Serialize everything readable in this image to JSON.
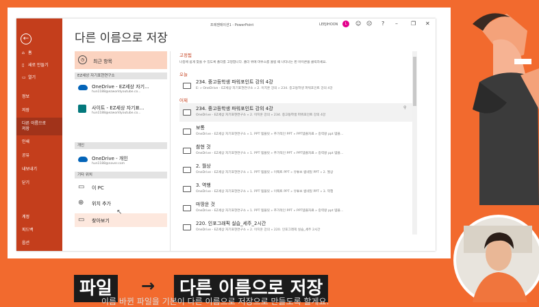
{
  "app": {
    "doc_title": "프레젠테이션1 - PowerPoint",
    "user_name": "LEEJIHOON",
    "user_initial": "L",
    "page_title": "다른 이름으로 저장"
  },
  "nav": {
    "back_icon": "←",
    "items": [
      {
        "icon": "⌂",
        "label": "홈"
      },
      {
        "icon": "▯",
        "label": "새로 만들기"
      },
      {
        "icon": "▭",
        "label": "열기"
      },
      {
        "icon": "",
        "label": "정보"
      },
      {
        "icon": "",
        "label": "저장"
      },
      {
        "icon": "",
        "label": "다른 이름으로"
      },
      {
        "icon": "",
        "label": "저장"
      },
      {
        "icon": "",
        "label": "인쇄"
      },
      {
        "icon": "",
        "label": "공유"
      },
      {
        "icon": "",
        "label": "내보내기"
      },
      {
        "icon": "",
        "label": "닫기"
      },
      {
        "icon": "",
        "label": "계정"
      },
      {
        "icon": "",
        "label": "피드백"
      },
      {
        "icon": "",
        "label": "옵션"
      }
    ]
  },
  "locations": {
    "recent": "최근 항목",
    "section_org": "EZ세상 자기표현연구소",
    "org_items": [
      {
        "line1": "OneDrive - EZ세상 자기...",
        "line2": "hun1188@ezworldyoutube.co..."
      },
      {
        "line1": "사이트 - EZ세상 자기표...",
        "line2": "hun1188@ezworldyoutube.co..."
      }
    ],
    "section_personal": "개인",
    "personal_items": [
      {
        "line1": "OneDrive - 개인",
        "line2": "hun1188@naver.com"
      }
    ],
    "section_other": "기타 위치",
    "other_items": [
      {
        "label": "이 PC"
      },
      {
        "label": "위치 추가"
      },
      {
        "label": "찾아보기"
      }
    ]
  },
  "files": {
    "pinned_header": "고정됨",
    "pinned_desc": "나중에 쉽게 찾을 수 있도록 폴더를 고정합니다. 폴더 위에 마우스를 올릴 때 나타나는 핀 아이콘을 클릭하세요.",
    "today_header": "오늘",
    "yesterday_header": "어제",
    "today": [
      {
        "name": "234. 중고등학생 파워포인트 강의 4강",
        "path": "E: » OneDrive - EZ세상 자기표현연구소 » 2. 이지훈 강의 » 234. 중고등학생 파워포인트 강의 4강"
      }
    ],
    "yesterday": [
      {
        "name": "234. 중고등학생 파워포인트 강의 4강",
        "path": "OneDrive - EZ세상 자기표현연구소 » 2. 이지훈 강의 » 234. 중고등학생 파워포인트 강의 4강"
      },
      {
        "name": "보통",
        "path": "OneDrive - EZ세상 자기표현연구소 » 1. PPT 템플릿 » 추가적인 PPT » PPT템플자료 » 중력왕 ppt 템플..."
      },
      {
        "name": "참현 것",
        "path": "OneDrive - EZ세상 자기표현연구소 » 1. PPT 템플릿 » 추가적인 PPT » PPT템플자료 » 중력왕 ppt 템플..."
      },
      {
        "name": "2. 월상",
        "path": "OneDrive - EZ세상 자기표현연구소 » 1. PPT 템플릿 » 이펙트 PPT » 유튜브 썸네일 PPT » 2. 월상"
      },
      {
        "name": "3. 역행",
        "path": "OneDrive - EZ세상 자기표현연구소 » 1. PPT 템플릿 » 이펙트 PPT » 유튜브 썸네일 PPT » 3. 역행"
      },
      {
        "name": "마땅운 것",
        "path": "OneDrive - EZ세상 자기표현연구소 » 1. PPT 템플릿 » 추가적인 PPT » PPT템플자료 » 중력왕 ppt 템플..."
      },
      {
        "name": "220. 인포그래픽 실습_세주_2시간",
        "path": "OneDrive - EZ세상 자기표현연구소 » 2. 이지훈 강의 » 220. 인포그래픽 실습_세주 2시간"
      }
    ]
  },
  "caption": {
    "part1": "파일",
    "arrow": "→",
    "part2": "다른 이름으로 저장",
    "subtitle": "이름 바뀐 파일을 기본이 다른 이름으로 저장으로 만들도록 할게요."
  },
  "colors": {
    "background": "#f26a2e",
    "nav": "#c43e1c",
    "accent": "#c43e1c"
  }
}
